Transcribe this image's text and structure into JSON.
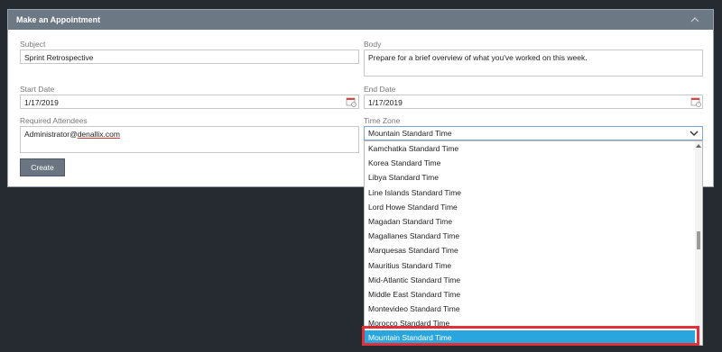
{
  "panel": {
    "title": "Make an Appointment"
  },
  "form": {
    "subject_label": "Subject",
    "subject_value": "Sprint Retrospective",
    "body_label": "Body",
    "body_value": "Prepare for a brief overview of what you've worked on this week.",
    "start_date_label": "Start Date",
    "start_date_value": "1/17/2019",
    "end_date_label": "End Date",
    "end_date_value": "1/17/2019",
    "attendees_label": "Required Attendees",
    "attendees_prefix": "Administrator@",
    "attendees_domain": "denallix.com",
    "timezone_label": "Time Zone",
    "timezone_value": "Mountain Standard Time",
    "create_label": "Create"
  },
  "dropdown": {
    "items": [
      "Kamchatka Standard Time",
      "Korea Standard Time",
      "Libya Standard Time",
      "Line Islands Standard Time",
      "Lord Howe Standard Time",
      "Magadan Standard Time",
      "Magallanes Standard Time",
      "Marquesas Standard Time",
      "Mauritius Standard Time",
      "Mid-Atlantic Standard Time",
      "Middle East Standard Time",
      "Montevideo Standard Time",
      "Morocco Standard Time",
      "Mountain Standard Time"
    ],
    "selected_index": 13
  },
  "colors": {
    "header_bg": "#6d7885",
    "selected_bg": "#2aa6df",
    "highlight_border": "#e0303a"
  }
}
